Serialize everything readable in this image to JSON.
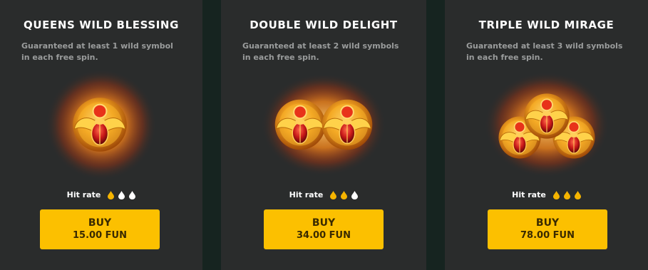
{
  "colors": {
    "card_bg": "#2a2c2c",
    "gap_bg": "#162420",
    "button_bg": "#fcc000",
    "button_text": "#3a2a00",
    "drop_filled": "#f5b400",
    "drop_empty": "#ffffff"
  },
  "cards": [
    {
      "title": "QUEENS WILD BLESSING",
      "description": "Guaranteed at least 1 wild symbol in each free spin.",
      "icon": "scarab-coin-icon",
      "coin_count": 1,
      "hit_rate_label": "Hit rate",
      "hit_rate_level": 1,
      "hit_rate_max": 3,
      "buy_label": "BUY",
      "price": "15.00 FUN"
    },
    {
      "title": "DOUBLE WILD DELIGHT",
      "description": "Guaranteed at least 2 wild symbols in each free spin.",
      "icon": "scarab-coin-icon",
      "coin_count": 2,
      "hit_rate_label": "Hit rate",
      "hit_rate_level": 2,
      "hit_rate_max": 3,
      "buy_label": "BUY",
      "price": "34.00 FUN"
    },
    {
      "title": "TRIPLE WILD MIRAGE",
      "description": "Guaranteed at least 3 wild symbols in each free spin.",
      "icon": "scarab-coin-icon",
      "coin_count": 3,
      "hit_rate_label": "Hit rate",
      "hit_rate_level": 3,
      "hit_rate_max": 3,
      "buy_label": "BUY",
      "price": "78.00 FUN"
    }
  ]
}
